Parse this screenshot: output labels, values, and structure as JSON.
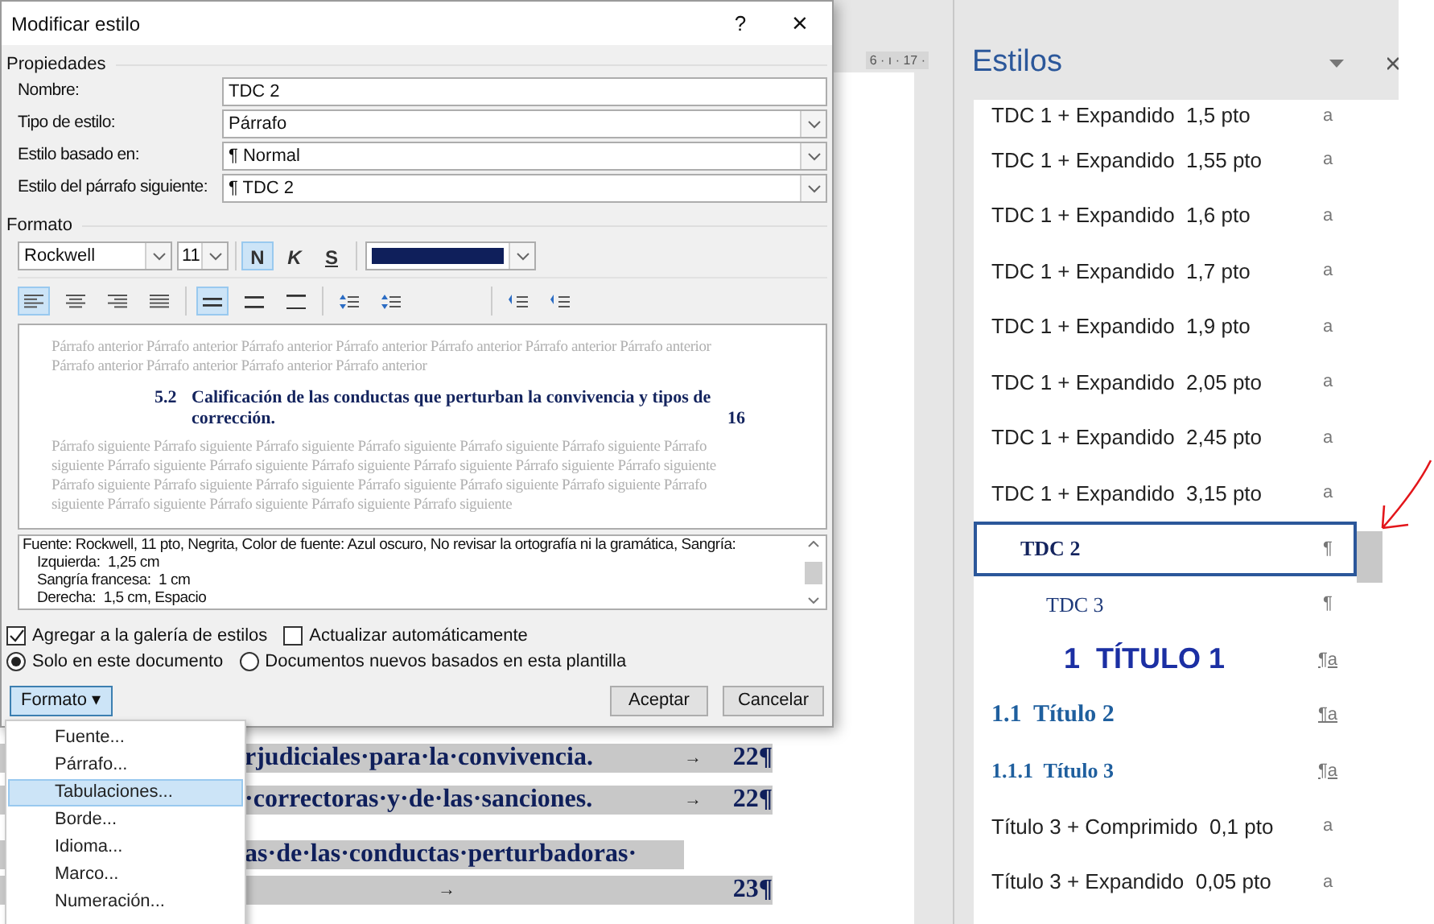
{
  "dialog": {
    "title": "Modificar estilo",
    "help": "?",
    "close": "×",
    "properties": {
      "heading": "Propiedades",
      "rows": [
        {
          "kind": "input",
          "label": "Nombre:",
          "value": "TDC 2"
        },
        {
          "kind": "select",
          "label": "Tipo de estilo:",
          "value": "Párrafo"
        },
        {
          "kind": "select",
          "label": "Estilo basado en:",
          "value": "¶ Normal"
        },
        {
          "kind": "select",
          "label": "Estilo del párrafo siguiente:",
          "value": "¶ TDC 2"
        }
      ]
    },
    "format": {
      "heading": "Formato",
      "font": "Rockwell",
      "size": "11",
      "style_buttons": [
        {
          "label": "N",
          "kind": "bold",
          "selected": true
        },
        {
          "label": "K",
          "kind": "italic",
          "selected": false
        },
        {
          "label": "S",
          "kind": "underline",
          "selected": false
        }
      ],
      "alignment": [
        {
          "kind": "left",
          "selected": true
        },
        {
          "kind": "center",
          "selected": false
        },
        {
          "kind": "right",
          "selected": false
        },
        {
          "kind": "justify",
          "selected": false
        }
      ],
      "line_spacing": [
        {
          "kind": "single",
          "selected": true
        },
        {
          "kind": "one-half",
          "selected": false
        },
        {
          "kind": "double",
          "selected": false
        }
      ]
    },
    "preview": {
      "previous": "Párrafo anterior Párrafo anterior Párrafo anterior Párrafo anterior Párrafo anterior Párrafo anterior Párrafo anterior Párrafo anterior Párrafo anterior Párrafo anterior Párrafo anterior",
      "number": "5.2",
      "heading": "Calificación de las conductas que perturban la convivencia y tipos de corrección.",
      "page": "16",
      "next": "Párrafo siguiente Párrafo siguiente Párrafo siguiente Párrafo siguiente Párrafo siguiente Párrafo siguiente Párrafo siguiente Párrafo siguiente Párrafo siguiente Párrafo siguiente Párrafo siguiente Párrafo siguiente Párrafo siguiente Párrafo siguiente Párrafo siguiente Párrafo siguiente Párrafo siguiente Párrafo siguiente Párrafo siguiente Párrafo siguiente Párrafo siguiente Párrafo siguiente Párrafo siguiente Párrafo siguiente"
    },
    "description": [
      "Fuente: Rockwell, 11 pto, Negrita, Color de fuente: Azul oscuro, No revisar la ortografía ni la gramática, Sangría:",
      "Izquierda:  1,25 cm",
      "Sangría francesa:  1 cm",
      "Derecha:  1,5 cm, Espacio"
    ],
    "checkboxes": [
      {
        "label": "Agregar a la galería de estilos",
        "checked": true
      },
      {
        "label": "Actualizar automáticamente",
        "checked": false
      }
    ],
    "radios": [
      {
        "label": "Solo en este documento",
        "selected": true
      },
      {
        "label": "Documentos nuevos basados en esta plantilla",
        "selected": false
      }
    ],
    "format_button": "Formato ▾",
    "ok": "Aceptar",
    "cancel": "Cancelar"
  },
  "format_menu": [
    {
      "label": "Fuente...",
      "selected": false
    },
    {
      "label": "Párrafo...",
      "selected": false
    },
    {
      "label": "Tabulaciones...",
      "selected": true
    },
    {
      "label": "Borde...",
      "selected": false
    },
    {
      "label": "Idioma...",
      "selected": false
    },
    {
      "label": "Marco...",
      "selected": false
    },
    {
      "label": "Numeración...",
      "selected": false
    }
  ],
  "ruler": "6 · ı · 17 ·",
  "document_lines": [
    {
      "kind": "entry",
      "text": "rjudiciales·para·la·convivencia.",
      "tab": "→",
      "page": "22¶"
    },
    {
      "kind": "entry",
      "text": "·correctoras·y·de·las·sanciones.",
      "tab": "→",
      "page": "22¶"
    },
    {
      "kind": "text",
      "text": "as·de·las·conductas·perturbadoras·"
    },
    {
      "kind": "wrapped",
      "tab": "→",
      "page": "23¶"
    }
  ],
  "styles_pane": {
    "title": "Estilos",
    "items": [
      {
        "label": "TDC 1 + Expandido  1,5 pto",
        "kind": "plain",
        "marker": "a",
        "selected": false
      },
      {
        "label": "TDC 1 + Expandido  1,55 pto",
        "kind": "plain",
        "marker": "a",
        "selected": false
      },
      {
        "label": "TDC 1 + Expandido  1,6 pto",
        "kind": "plain",
        "marker": "a",
        "selected": false
      },
      {
        "label": "TDC 1 + Expandido  1,7 pto",
        "kind": "plain",
        "marker": "a",
        "selected": false
      },
      {
        "label": "TDC 1 + Expandido  1,9 pto",
        "kind": "plain",
        "marker": "a",
        "selected": false
      },
      {
        "label": "TDC 1 + Expandido  2,05 pto",
        "kind": "plain",
        "marker": "a",
        "selected": false
      },
      {
        "label": "TDC 1 + Expandido  2,45 pto",
        "kind": "plain",
        "marker": "a",
        "selected": false
      },
      {
        "label": "TDC 1 + Expandido  3,15 pto",
        "kind": "plain",
        "marker": "a",
        "selected": false
      },
      {
        "label": "TDC 2",
        "kind": "toc2",
        "marker": "¶",
        "selected": true
      },
      {
        "label": "TDC 3",
        "kind": "toc3",
        "marker": "¶",
        "selected": false
      },
      {
        "label": "1  TÍTULO 1",
        "kind": "heading1",
        "marker": "¶a",
        "selected": false
      },
      {
        "label": "1.1  Título 2",
        "kind": "heading2",
        "marker": "¶a",
        "selected": false
      },
      {
        "label": "1.1.1  Título 3",
        "kind": "heading3",
        "marker": "¶a",
        "selected": false
      },
      {
        "label": "Título 3 + Comprimido  0,1 pto",
        "kind": "plain",
        "marker": "a",
        "selected": false
      },
      {
        "label": "Título 3 + Expandido  0,05 pto",
        "kind": "plain",
        "marker": "a",
        "selected": false
      }
    ]
  }
}
